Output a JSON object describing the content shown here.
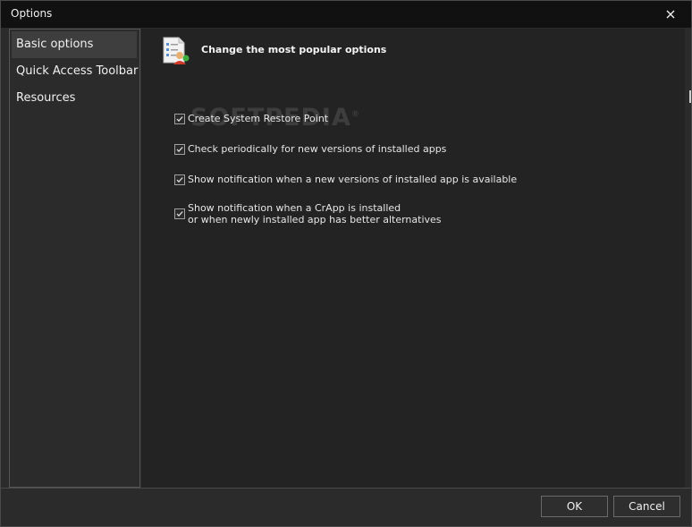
{
  "window": {
    "title": "Options"
  },
  "sidebar": {
    "items": [
      {
        "label": "Basic options",
        "active": true
      },
      {
        "label": "Quick Access Toolbar",
        "active": false
      },
      {
        "label": "Resources",
        "active": false
      }
    ]
  },
  "content": {
    "section_title": "Change the most popular options",
    "section_icon": "settings-list-icon",
    "options": [
      {
        "label": "Create System Restore Point",
        "checked": true
      },
      {
        "label": "Check periodically for new versions of installed apps",
        "checked": true
      },
      {
        "label": "Show notification when a new versions of installed app is available",
        "checked": true
      },
      {
        "label_line1": "Show notification when a CrApp is installed",
        "label_line2": "or when newly installed app has better alternatives",
        "checked": true
      }
    ]
  },
  "watermark": {
    "text": "SOFTPEDIA",
    "mark": "®"
  },
  "footer": {
    "ok_label": "OK",
    "cancel_label": "Cancel"
  },
  "colors": {
    "titlebar": "#111111",
    "background": "#2b2b2b",
    "content": "#232323",
    "active_item": "#3e3e3e"
  }
}
